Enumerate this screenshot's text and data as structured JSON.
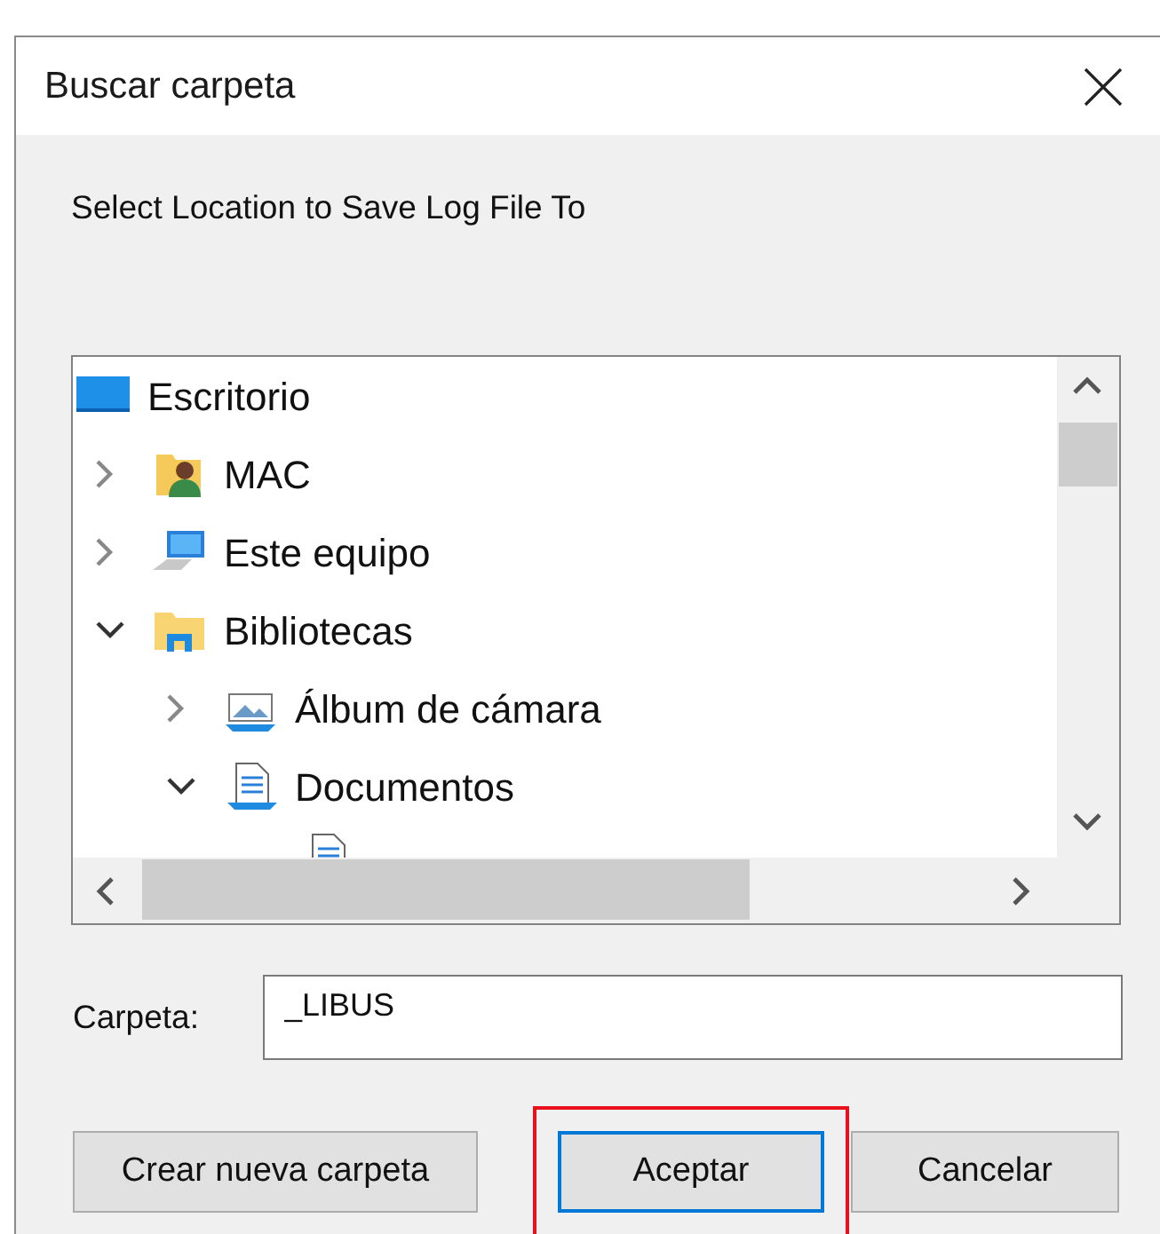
{
  "window": {
    "title": "Buscar carpeta"
  },
  "prompt": "Select Location to Save Log File To",
  "tree": {
    "label": "Escritorio",
    "kind": "desktop",
    "children": [
      {
        "label": "MAC",
        "kind": "user",
        "expanded": false
      },
      {
        "label": "Este equipo",
        "kind": "computer",
        "expanded": false
      },
      {
        "label": "Bibliotecas",
        "kind": "library",
        "expanded": true,
        "children": [
          {
            "label": "Álbum de cámara",
            "kind": "pictures",
            "expanded": false
          },
          {
            "label": "Documentos",
            "kind": "documents",
            "expanded": true
          }
        ]
      }
    ]
  },
  "folder_field": {
    "label": "Carpeta:",
    "value": "_LIBUS"
  },
  "buttons": [
    {
      "label": "Crear nueva carpeta",
      "default": false,
      "highlighted": false
    },
    {
      "label": "Aceptar",
      "default": true,
      "highlighted": true
    },
    {
      "label": "Cancelar",
      "default": false,
      "highlighted": false
    }
  ]
}
